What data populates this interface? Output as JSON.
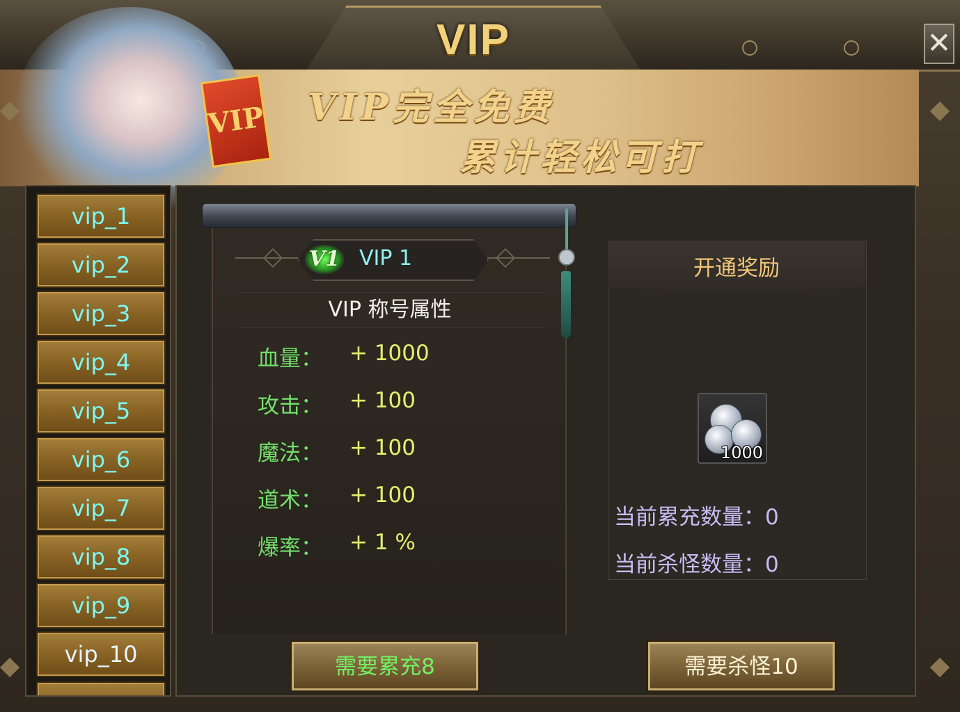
{
  "window": {
    "title": "VIP",
    "close_label": "✕"
  },
  "banner": {
    "line1": "VIP完全免费",
    "line2": "累计轻松可打",
    "card_text": "VIP"
  },
  "sidebar": {
    "items": [
      {
        "label": "vip_1"
      },
      {
        "label": "vip_2"
      },
      {
        "label": "vip_3"
      },
      {
        "label": "vip_4"
      },
      {
        "label": "vip_5"
      },
      {
        "label": "vip_6"
      },
      {
        "label": "vip_7"
      },
      {
        "label": "vip_8"
      },
      {
        "label": "vip_9"
      },
      {
        "label": "vip_10"
      }
    ]
  },
  "detail": {
    "badge": "V1",
    "level_title": "VIP 1",
    "section_title": "VIP 称号属性",
    "attributes": [
      {
        "label": "血量：",
        "value": "+ 1000"
      },
      {
        "label": "攻击：",
        "value": "+ 100"
      },
      {
        "label": "魔法：",
        "value": "+ 100"
      },
      {
        "label": "道术：",
        "value": "+ 100"
      },
      {
        "label": "爆率：",
        "value": "+ 1 %"
      }
    ]
  },
  "reward": {
    "title": "开通奖励",
    "item_icon": "silver-coins-icon",
    "item_count": "1000",
    "current_recharge": "当前累充数量：0",
    "current_kills": "当前杀怪数量：0"
  },
  "buttons": {
    "require_recharge": "需要累充8",
    "require_kills": "需要杀怪10"
  },
  "colors": {
    "tab_text": "#7df8f2",
    "attr_label": "#73e06b",
    "attr_value": "#e4f06a",
    "reward_title": "#f1c57a",
    "stat_text": "#c5bdf2"
  }
}
